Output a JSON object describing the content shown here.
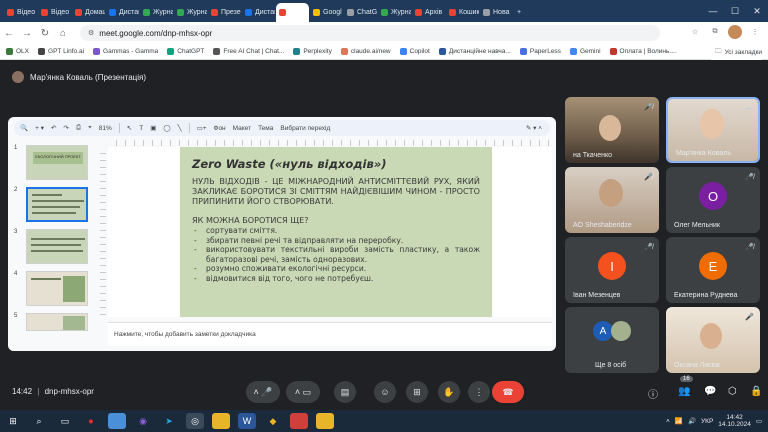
{
  "browser": {
    "tabs": [
      {
        "label": "Відео",
        "color": "#ea4335"
      },
      {
        "label": "Відео",
        "color": "#ea4335"
      },
      {
        "label": "Домаш",
        "color": "#ea4335"
      },
      {
        "label": "Дистан",
        "color": "#1a73e8"
      },
      {
        "label": "Журна",
        "color": "#34a853"
      },
      {
        "label": "Журна",
        "color": "#34a853"
      },
      {
        "label": "Презе",
        "color": "#ea4335"
      },
      {
        "label": "Дистан",
        "color": "#1a73e8"
      },
      {
        "label": "",
        "color": "#ea4335",
        "active": true
      },
      {
        "label": "Googl",
        "color": "#fbbc04"
      },
      {
        "label": "ChatG",
        "color": "#9aa0a6"
      },
      {
        "label": "Журна",
        "color": "#34a853"
      },
      {
        "label": "Архів",
        "color": "#ea4335"
      },
      {
        "label": "Кошик",
        "color": "#ea4335"
      },
      {
        "label": "Нова",
        "color": "#9aa0a6"
      }
    ],
    "url": "meet.google.com/dnp-mhsx-opr",
    "bookmarks": [
      "OLX",
      "GPT Linfo.ai",
      "Gammas - Gamma",
      "ChatGPT",
      "Free AI Chat | Chat...",
      "Perplexity",
      "claude.ai/new",
      "Copilot",
      "Дистанційне навча...",
      "PaperLess",
      "Gemini",
      "Оплата | Волинь...."
    ],
    "bookmarks_all": "Усі закладки"
  },
  "meet": {
    "presenter": "Мар'янка Коваль (Презентація)",
    "clock": "14:42",
    "meeting_code": "dnp-mhsx-opr",
    "participants_count": "16",
    "participants": [
      {
        "name": "на Ткаченко",
        "type": "camera",
        "color": "#7a6a58"
      },
      {
        "name": "Мар'янка Коваль",
        "type": "camera",
        "color": "#b9a48c",
        "active": true
      },
      {
        "name": "AO Sheshaberidze",
        "type": "camera",
        "color": "#b3a089"
      },
      {
        "name": "Олег Мельник",
        "type": "avatar",
        "initial": "О",
        "color": "#7b1fa2"
      },
      {
        "name": "Іван Мезенцев",
        "type": "avatar",
        "initial": "І",
        "color": "#f4511e"
      },
      {
        "name": "Екатерина Руднева",
        "type": "avatar",
        "initial": "Е",
        "color": "#ef6c00"
      },
      {
        "name": "Ще 8 осіб",
        "type": "group",
        "initial": "А",
        "color": "#1e5db5"
      },
      {
        "name": "Оксана Лисюк",
        "type": "camera",
        "color": "#c8b79f"
      }
    ]
  },
  "slides_app": {
    "zoom": "81%",
    "toolbar": [
      "Фон",
      "Макет",
      "Тема",
      "Вибрати перехід"
    ],
    "thumbnails": [
      {
        "num": "1",
        "title": "ЕКОЛОГІЧНИЙ ПРОЕКТ"
      },
      {
        "num": "2",
        "selected": true
      },
      {
        "num": "3"
      },
      {
        "num": "4"
      },
      {
        "num": "5"
      }
    ],
    "notes_placeholder": "Нажмите, чтобы добавить заметки докладчика",
    "slide": {
      "title": "Zero Waste («нуль відходів»)",
      "body": "Нуль відходів - це міжнародний антисміттєвий рух, який закликає боротися зі сміттям найдієвішим чином - просто припинити його створювати.",
      "question": "Як можна боротися ще?",
      "items": [
        "сортувати сміття.",
        "збирати певні речі та відправляти на переробку.",
        "використовувати текстильні вироби замість пластику, а також багаторазові речі, замість одноразових.",
        "розумно споживати екологічні ресурси.",
        "відмовитися від того, чого не потребуєш."
      ]
    }
  },
  "taskbar": {
    "lang": "УКР",
    "time": "14:42",
    "date": "14.10.2024"
  }
}
